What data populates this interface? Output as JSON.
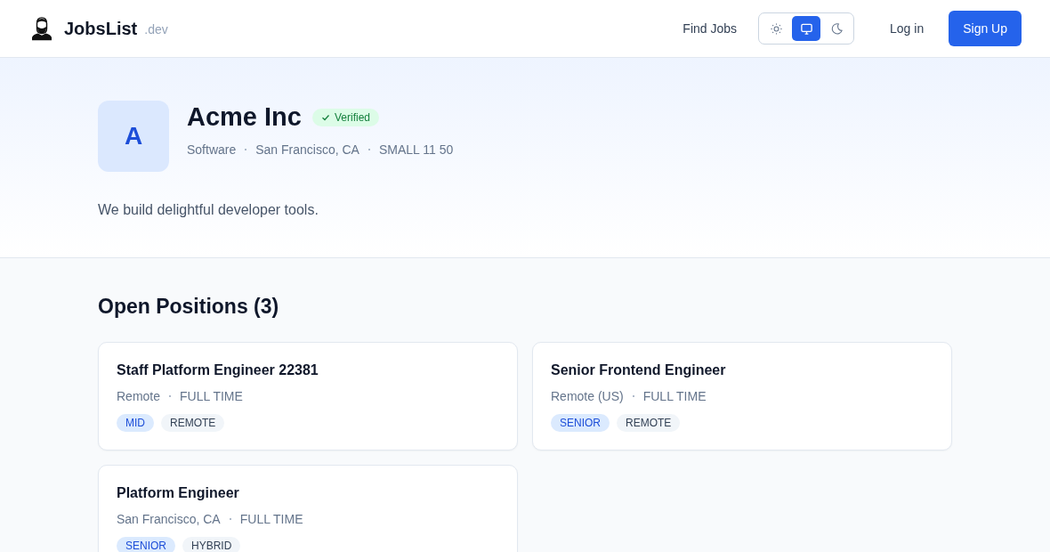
{
  "header": {
    "brand": "JobsList",
    "brand_suffix": ".dev",
    "nav": [
      {
        "label": "Find Jobs"
      }
    ],
    "theme_toggle": [
      {
        "kind": "light",
        "selected": false
      },
      {
        "kind": "system",
        "selected": true
      },
      {
        "kind": "dark",
        "selected": false
      }
    ],
    "login": "Log in",
    "signup": "Sign Up"
  },
  "company": {
    "initial": "A",
    "name": "Acme Inc",
    "verified": true,
    "verified_label": "Verified",
    "meta": [
      "Software",
      "San Francisco, CA",
      "SMALL 11 50"
    ],
    "description": "We build delightful developer tools."
  },
  "positions": {
    "title": "Open Positions (3)",
    "jobs": [
      {
        "title": "Staff Platform Engineer 22381",
        "meta": [
          "Remote",
          "FULL TIME"
        ],
        "tags": [
          {
            "label": "MID",
            "kind": "level"
          },
          {
            "label": "REMOTE",
            "kind": "workplace"
          }
        ]
      },
      {
        "title": "Senior Frontend Engineer",
        "meta": [
          "Remote (US)",
          "FULL TIME"
        ],
        "tags": [
          {
            "label": "SENIOR",
            "kind": "level"
          },
          {
            "label": "REMOTE",
            "kind": "workplace"
          }
        ]
      },
      {
        "title": "Platform Engineer",
        "meta": [
          "San Francisco, CA",
          "FULL TIME"
        ],
        "tags": [
          {
            "label": "SENIOR",
            "kind": "level"
          },
          {
            "label": "HYBRID",
            "kind": "workplace"
          }
        ]
      }
    ]
  }
}
